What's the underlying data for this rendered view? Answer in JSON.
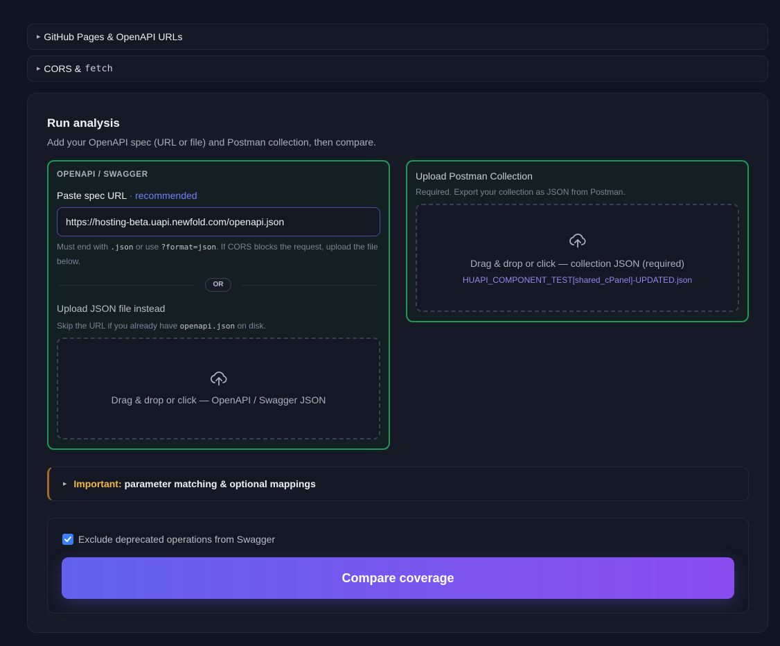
{
  "accordions": {
    "github_pages": {
      "label": "GitHub Pages & OpenAPI URLs"
    },
    "cors": {
      "label": "CORS &",
      "code": "fetch"
    }
  },
  "analysis": {
    "title": "Run analysis",
    "subtitle": "Add your OpenAPI spec (URL or file) and Postman collection, then compare.",
    "openapi": {
      "section_label": "OPENAPI / SWAGGER",
      "paste_label": "Paste spec URL",
      "recommended": "· recommended",
      "url_value": "https://hosting-beta.uapi.newfold.com/openapi.json",
      "hint_prefix": "Must end with",
      "hint_code1": ".json",
      "hint_middle": "or use",
      "hint_code2": "?format=json",
      "hint_suffix": ". If CORS blocks the request, upload the file below.",
      "or": "OR",
      "upload_label": "Upload JSON file instead",
      "skip_prefix": "Skip the URL if you already have",
      "skip_code": "openapi.json",
      "skip_suffix": "on disk.",
      "drop_text": "Drag & drop or click — OpenAPI / Swagger JSON"
    },
    "postman": {
      "title": "Upload Postman Collection",
      "subtitle": "Required. Export your collection as JSON from Postman.",
      "drop_text": "Drag & drop or click — collection JSON (required)",
      "file_name": "HUAPI_COMPONENT_TEST[shared_cPanel]-UPDATED.json"
    },
    "important": {
      "label": "Important:",
      "text": "parameter matching & optional mappings"
    },
    "options": {
      "exclude_deprecated_label": "Exclude deprecated operations from Swagger",
      "exclude_deprecated_checked": true,
      "compare_button": "Compare coverage"
    }
  },
  "colors": {
    "accent": "#6b5cf0",
    "success_border": "#1f9a55",
    "warning": "#f5b940",
    "link": "#7b7ff5"
  }
}
